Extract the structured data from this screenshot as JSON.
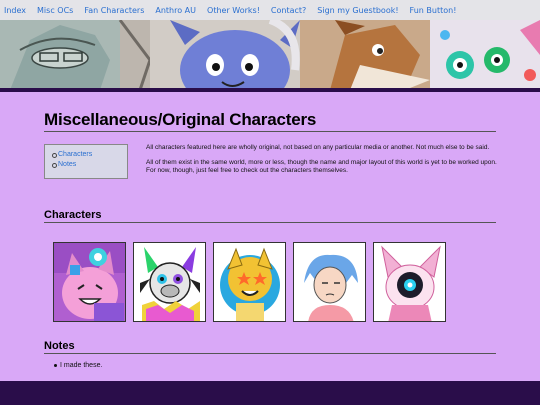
{
  "nav": {
    "items": [
      {
        "label": "Index"
      },
      {
        "label": "Misc OCs"
      },
      {
        "label": "Fan Characters"
      },
      {
        "label": "Anthro AU"
      },
      {
        "label": "Other Works!"
      },
      {
        "label": "Contact?"
      },
      {
        "label": "Sign my Guestbook!"
      },
      {
        "label": "Fun Button!"
      }
    ]
  },
  "page": {
    "title": "Miscellaneous/Original Characters"
  },
  "toc": {
    "items": [
      {
        "label": "Characters"
      },
      {
        "label": "Notes"
      }
    ]
  },
  "intro": {
    "paragraph_1": "All characters featured here are wholly original, not based on any particular media or another. Not much else to be said.",
    "paragraph_2": "All of them exist in the same world, more or less, though the name and major layout of this world is yet to be worked upon. For now, though, just feel free to check out the characters themselves."
  },
  "sections": {
    "characters_heading": "Characters",
    "notes_heading": "Notes"
  },
  "characters": [
    {
      "icon": "character-thumbnail-pink-cat"
    },
    {
      "icon": "character-thumbnail-clown-goat"
    },
    {
      "icon": "character-thumbnail-star-face"
    },
    {
      "icon": "character-thumbnail-blue-hair"
    },
    {
      "icon": "character-thumbnail-pink-robot"
    }
  ],
  "notes": {
    "items": [
      "I made these."
    ]
  },
  "colors": {
    "background": "#d9a8f7",
    "nav_bar": "#e4e4e8",
    "link": "#2a6fd0",
    "footer": "#2a0d4a"
  }
}
